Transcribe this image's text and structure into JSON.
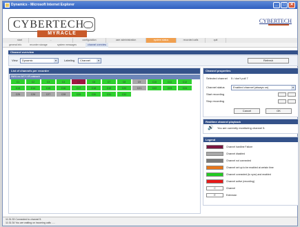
{
  "window": {
    "title": "Dynamics - Microsoft Internet Explorer",
    "minimize": "_",
    "maximize": "□",
    "close": "✕"
  },
  "brand": {
    "logo_main": "CYBERTECH",
    "logo_sub": "MYRACLE",
    "right_logo": "CYBERTECH"
  },
  "nav": {
    "tabs": [
      "start",
      "...",
      "configuration",
      "user administration",
      "system status",
      "recorded calls",
      "quit"
    ],
    "active": "system status"
  },
  "subnav": {
    "tabs": [
      "general info",
      "recorder storage",
      "system messages",
      "channel overview"
    ],
    "active": "channel overview"
  },
  "overview": {
    "header": "Channel overview",
    "view_label": "View",
    "view_value": "Dynamic",
    "labeling_label": "Labeling",
    "labeling_value": "Channel",
    "refresh": "Refresh"
  },
  "channels": {
    "header": "List of channels per recorder",
    "subheader": "NWU-cs-WCY-VR-wisbach",
    "rows": [
      [
        "C1",
        "C2",
        "C3",
        "C4",
        "C5",
        "C6",
        "C7",
        "C8",
        "C9",
        "C10",
        "C11",
        "C12"
      ],
      [
        "C13",
        "C14",
        "C15",
        "C16",
        "C17",
        "C18",
        "C19",
        "C20",
        "C21",
        "C22",
        "C23",
        "C24"
      ],
      [
        "C25",
        "C26",
        "C27",
        "C28",
        "C29",
        "C30",
        "C31",
        "C32"
      ]
    ],
    "states": [
      [
        "green",
        "green",
        "green",
        "green",
        "red",
        "green",
        "green",
        "green",
        "gray",
        "green",
        "green",
        "green"
      ],
      [
        "green",
        "green",
        "green",
        "green",
        "green",
        "green",
        "green",
        "green",
        "gray",
        "green",
        "green",
        "green"
      ],
      [
        "gray",
        "gray",
        "gray",
        "gray",
        "green",
        "green",
        "green",
        "green"
      ]
    ]
  },
  "props": {
    "header": "Channel properties",
    "selected_label": "Selected channel",
    "selected_value": "5 / don't pull 7",
    "status_label": "Channel status",
    "status_value": "Enabled channel (always on)",
    "start_label": "Start recording",
    "stop_label": "Stop recording",
    "cancel": "Cancel",
    "ok": "OK"
  },
  "playback": {
    "header": "Realtime channel playback",
    "message": "You are currently monitoring channel 5."
  },
  "legend": {
    "header": "Legend",
    "items": [
      {
        "color": "#7a1540",
        "text": "Channel hardline Failure",
        "mark": ""
      },
      {
        "color": "#a8a8a8",
        "text": "Channel disabled",
        "mark": ""
      },
      {
        "color": "#7a7a7a",
        "text": "Channel not connected",
        "mark": ""
      },
      {
        "color": "#e8761a",
        "text": "Channel set up to be enabled at certain time",
        "mark": ""
      },
      {
        "color": "#22cc22",
        "text": "Channel connected (to sync) and enabled",
        "mark": ""
      },
      {
        "color": "#e81818",
        "text": "Channel active (recording)",
        "mark": ""
      },
      {
        "color": "#ffffff",
        "text": "Channel",
        "mark": "C"
      },
      {
        "color": "#ffffff",
        "text": "Extension",
        "mark": "E"
      }
    ]
  },
  "status": {
    "lines": [
      "11:31:33   Connected to channel 5.",
      "11:31:34   You are waiting on incoming calls ....."
    ]
  }
}
